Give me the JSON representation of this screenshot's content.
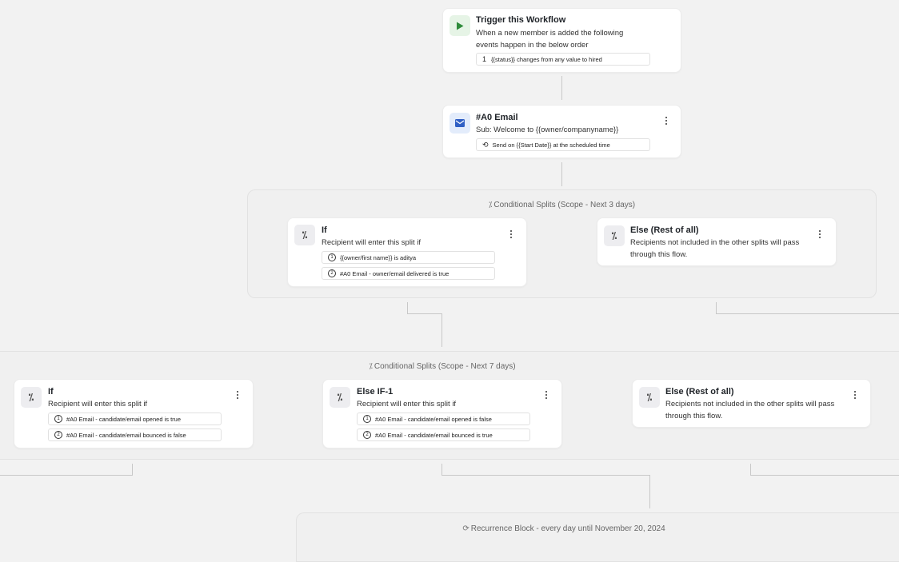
{
  "trigger": {
    "title": "Trigger this Workflow",
    "description": "When a new member is added the following events happen in the below order",
    "condition_num": "1",
    "condition": "{{status}} changes from any value to hired",
    "icon": "play-icon"
  },
  "email_step": {
    "title": "#A0 Email",
    "subject": "Sub: Welcome to {{owner/companyname}}",
    "schedule": "Send on {{Start Date}} at the scheduled time",
    "icon": "mail-icon"
  },
  "split1": {
    "label": "Conditional Splits (Scope - Next 3 days)",
    "if_card": {
      "title": "If",
      "subtitle": "Recipient will enter this split if",
      "conditions": [
        {
          "num": "1",
          "text": "{{owner/first name}} is aditya"
        },
        {
          "num": "2",
          "text": "#A0 Email - owner/email delivered is true"
        }
      ]
    },
    "else_card": {
      "title": "Else (Rest of all)",
      "subtitle": "Recipients not included in the other splits will pass through this flow."
    }
  },
  "split2": {
    "label": "Conditional Splits (Scope - Next 7 days)",
    "if_card": {
      "title": "If",
      "subtitle": "Recipient will enter this split if",
      "conditions": [
        {
          "num": "1",
          "text": "#A0 Email - candidate/email opened is true"
        },
        {
          "num": "2",
          "text": "#A0 Email - candidate/email bounced is false"
        }
      ]
    },
    "elseif_card": {
      "title": "Else IF-1",
      "subtitle": "Recipient will enter this split if",
      "conditions": [
        {
          "num": "1",
          "text": "#A0 Email - candidate/email opened is false"
        },
        {
          "num": "2",
          "text": "#A0 Email - candidate/email bounced is true"
        }
      ]
    },
    "else_card": {
      "title": "Else (Rest of all)",
      "subtitle": "Recipients not included in the other splits will pass through this flow."
    }
  },
  "recurrence": {
    "label": "Recurrence Block - every day until November 20, 2024",
    "icon": "repeat-icon"
  },
  "colors": {
    "background": "#f2f2f2",
    "trigger_icon": "#2e8b3a",
    "email_icon": "#2f5fc4",
    "connector": "#c8c8c8"
  }
}
